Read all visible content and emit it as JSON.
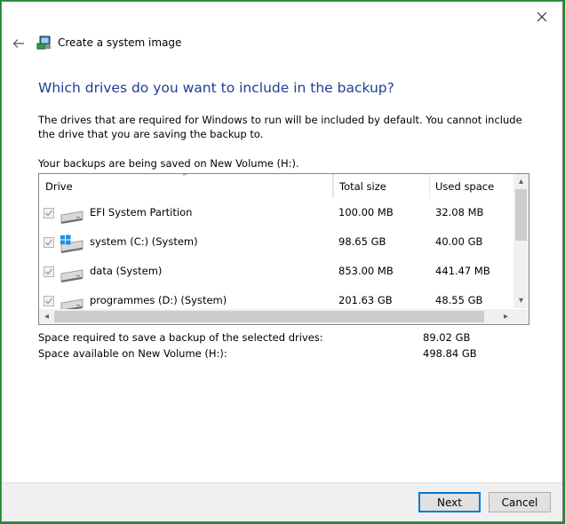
{
  "window": {
    "title": "Create a system image"
  },
  "heading": "Which drives do you want to include in the backup?",
  "description": "The drives that are required for Windows to run will be included by default. You cannot include the drive that you are saving the backup to.",
  "saving_location": "Your backups are being saved on New Volume (H:).",
  "columns": {
    "drive": "Drive",
    "total_size": "Total size",
    "used_space": "Used space"
  },
  "drives": [
    {
      "name": "EFI System Partition",
      "total": "100.00 MB",
      "used": "32.08 MB",
      "checked": true,
      "icon": "drive-icon"
    },
    {
      "name": "system (C:) (System)",
      "total": "98.65 GB",
      "used": "40.00 GB",
      "checked": true,
      "icon": "windows-drive-icon"
    },
    {
      "name": "data (System)",
      "total": "853.00 MB",
      "used": "441.47 MB",
      "checked": true,
      "icon": "drive-icon"
    },
    {
      "name": "programmes (D:) (System)",
      "total": "201.63 GB",
      "used": "48.55 GB",
      "checked": true,
      "icon": "drive-icon"
    }
  ],
  "summary": {
    "required_label": "Space required to save a backup of the selected drives:",
    "required_value": "89.02 GB",
    "available_label": "Space available on New Volume (H:):",
    "available_value": "498.84 GB"
  },
  "buttons": {
    "next": "Next",
    "cancel": "Cancel"
  },
  "colors": {
    "heading": "#1e3f91",
    "accent": "#0078d7",
    "desktop": "#1e8a2e"
  }
}
